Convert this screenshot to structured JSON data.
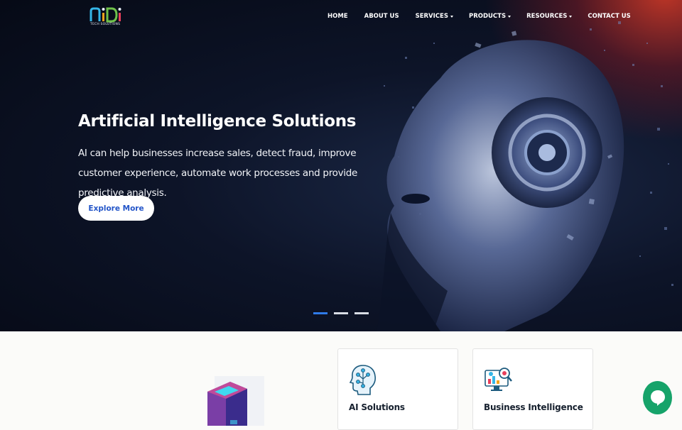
{
  "brand": {
    "logo_text": "niDi",
    "tagline": "TECH SOLUTIONS"
  },
  "nav": {
    "items": [
      {
        "label": "HOME",
        "dropdown": false
      },
      {
        "label": "ABOUT US",
        "dropdown": false
      },
      {
        "label": "SERVICES",
        "dropdown": true
      },
      {
        "label": "PRODUCTS",
        "dropdown": true
      },
      {
        "label": "RESOURCES",
        "dropdown": true
      },
      {
        "label": "CONTACT US",
        "dropdown": false
      }
    ]
  },
  "hero": {
    "title": "Artificial Intelligence Solutions",
    "text": "AI can help businesses increase sales, detect fraud, improve customer experience, automate work processes and provide predictive analysis.",
    "cta_label": "Explore More",
    "slides": {
      "count": 3,
      "active": 1
    }
  },
  "cards": [
    {
      "label": "AI Solutions",
      "icon": "ai-head-icon"
    },
    {
      "label": "Business Intelligence",
      "icon": "business-intelligence-icon"
    }
  ],
  "colors": {
    "accent": "#2f7be8",
    "cta_text": "#2355c8",
    "chat_button": "#16a36a",
    "hero_bg": "#0d1428"
  },
  "icons": {
    "chat": "chat-bubble-icon",
    "decor": "server-cube-icon"
  }
}
